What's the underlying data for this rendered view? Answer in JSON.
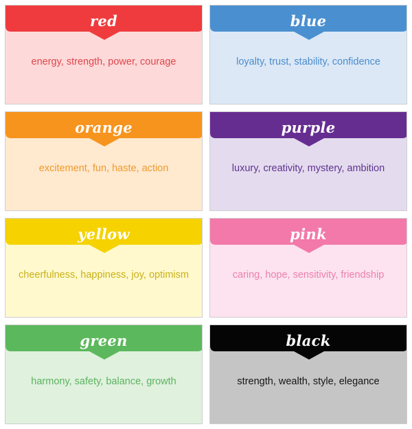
{
  "cards": [
    {
      "id": "red",
      "title": "red",
      "description": "energy, strength, power, courage",
      "header_color": "#ef3b3e",
      "body_color": "#fdd9da",
      "text_color": "#e0464a"
    },
    {
      "id": "blue",
      "title": "blue",
      "description": "loyalty, trust, stability, confidence",
      "header_color": "#4a90d0",
      "body_color": "#dce8f6",
      "text_color": "#4a8ccc"
    },
    {
      "id": "orange",
      "title": "orange",
      "description": "excitement, fun, haste, action",
      "header_color": "#f7941d",
      "body_color": "#ffe9cf",
      "text_color": "#ee9a2e"
    },
    {
      "id": "purple",
      "title": "purple",
      "description": "luxury, creativity, mystery, ambition",
      "header_color": "#662d91",
      "body_color": "#e4dbee",
      "text_color": "#5e3390"
    },
    {
      "id": "yellow",
      "title": "yellow",
      "description": "cheerfulness, happiness, joy, optimism",
      "header_color": "#f5d200",
      "body_color": "#fff9cd",
      "text_color": "#c9b11a"
    },
    {
      "id": "pink",
      "title": "pink",
      "description": "caring, hope, sensitivity, friendship",
      "header_color": "#f279aa",
      "body_color": "#fce3ef",
      "text_color": "#ec7fae"
    },
    {
      "id": "green",
      "title": "green",
      "description": "harmony, safety, balance, growth",
      "header_color": "#5cb85c",
      "body_color": "#e0f1de",
      "text_color": "#5cb360"
    },
    {
      "id": "black",
      "title": "black",
      "description": "strength, wealth, style, elegance",
      "header_color": "#050505",
      "body_color": "#c5c5c5",
      "text_color": "#151515"
    }
  ]
}
